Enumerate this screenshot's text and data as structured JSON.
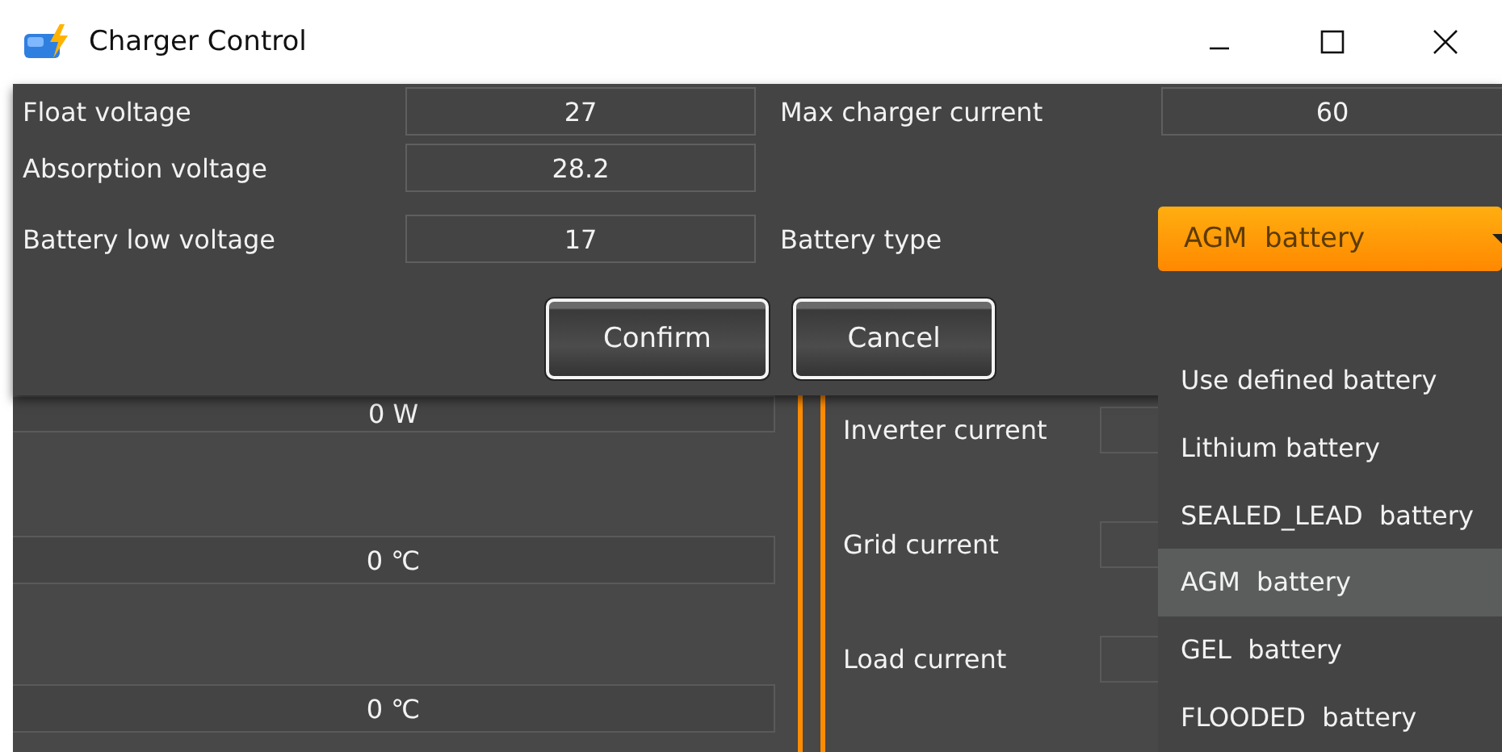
{
  "window": {
    "title": "Charger Control"
  },
  "settings": [
    {
      "label": "Float voltage",
      "value": "27"
    },
    {
      "label": "Absorption voltage",
      "value": "28.2"
    },
    {
      "label": "Battery low voltage",
      "value": "17"
    }
  ],
  "max_current": {
    "label": "Max charger current",
    "value": "60"
  },
  "battery_type": {
    "label": "Battery type",
    "value": "AGM  battery"
  },
  "buttons": [
    "Confirm",
    "Cancel"
  ],
  "dropdown": {
    "options": [
      {
        "label": "Use defined battery",
        "selected": false
      },
      {
        "label": "Lithium battery",
        "selected": false
      },
      {
        "label": "SEALED_LEAD  battery",
        "selected": false
      },
      {
        "label": "AGM  battery",
        "selected": true
      },
      {
        "label": "GEL  battery",
        "selected": false
      },
      {
        "label": "FLOODED  battery",
        "selected": false
      }
    ]
  },
  "background": {
    "readings": [
      "0 W",
      "0 ℃",
      "0 ℃"
    ],
    "currents": [
      {
        "label": "Inverter current"
      },
      {
        "label": "Grid current"
      },
      {
        "label": "Load current"
      }
    ]
  }
}
